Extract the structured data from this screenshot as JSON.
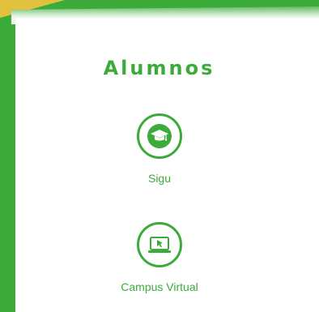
{
  "section": {
    "title": "Alumnos"
  },
  "links": [
    {
      "label": "Sigu",
      "icon": "graduation-cap-icon"
    },
    {
      "label": "Campus Virtual",
      "icon": "laptop-cursor-icon"
    }
  ],
  "colors": {
    "brand_green": "#3cab3a",
    "accent_yellow": "#f3c33f",
    "panel_bg": "#ffffff"
  }
}
